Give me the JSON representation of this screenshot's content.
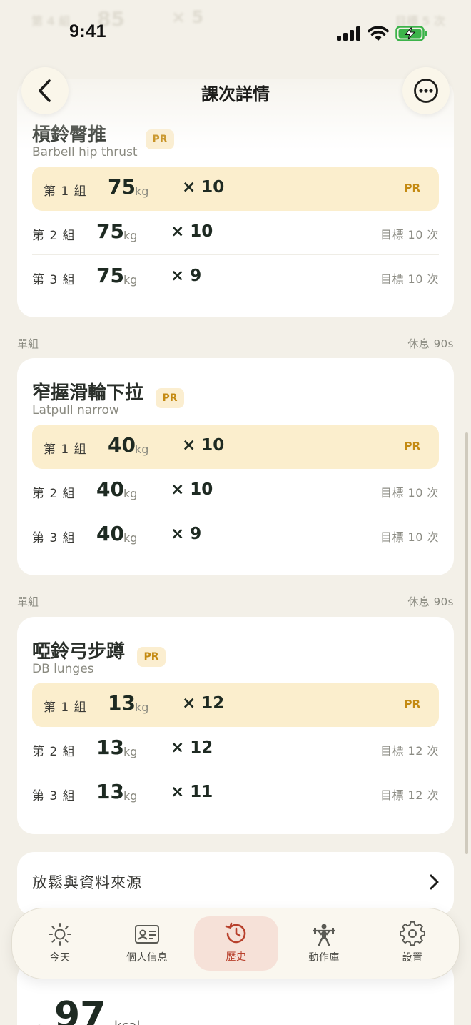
{
  "status_bar": {
    "time": "9:41"
  },
  "ghost_row": {
    "label": "第 4 組",
    "weight": "85",
    "reps": "× 5",
    "target": "目標 5 次"
  },
  "header": {
    "title": "課次詳情"
  },
  "exercises": [
    {
      "name": "槓鈴臀推",
      "subtitle": "Barbell hip thrust",
      "badge": "PR",
      "sets": [
        {
          "label": "第 1 組",
          "weight": "75",
          "unit": "kg",
          "reps": "× 10",
          "right": "PR"
        },
        {
          "label": "第 2 組",
          "weight": "75",
          "unit": "kg",
          "reps": "× 10",
          "right": "目標 10 次"
        },
        {
          "label": "第 3 組",
          "weight": "75",
          "unit": "kg",
          "reps": "× 9",
          "right": "目標 10 次"
        }
      ]
    },
    {
      "group_type": "單組",
      "rest": "休息 90s",
      "name": "窄握滑輪下拉",
      "subtitle": "Latpull narrow",
      "badge": "PR",
      "sets": [
        {
          "label": "第 1 組",
          "weight": "40",
          "unit": "kg",
          "reps": "× 10",
          "right": "PR"
        },
        {
          "label": "第 2 組",
          "weight": "40",
          "unit": "kg",
          "reps": "× 10",
          "right": "目標 10 次"
        },
        {
          "label": "第 3 組",
          "weight": "40",
          "unit": "kg",
          "reps": "× 9",
          "right": "目標 10 次"
        }
      ]
    },
    {
      "group_type": "單組",
      "rest": "休息 90s",
      "name": "啞鈴弓步蹲",
      "subtitle": "DB lunges",
      "badge": "PR",
      "sets": [
        {
          "label": "第 1 組",
          "weight": "13",
          "unit": "kg",
          "reps": "× 12",
          "right": "PR"
        },
        {
          "label": "第 2 組",
          "weight": "13",
          "unit": "kg",
          "reps": "× 12",
          "right": "目標 12 次"
        },
        {
          "label": "第 3 組",
          "weight": "13",
          "unit": "kg",
          "reps": "× 11",
          "right": "目標 12 次"
        }
      ]
    }
  ],
  "link_card": {
    "label": "放鬆與資料來源"
  },
  "bottom_card": {
    "value": "97",
    "unit": "kcal"
  },
  "tabs": [
    {
      "label": "今天",
      "icon": "sun-icon"
    },
    {
      "label": "個人信息",
      "icon": "id-card-icon"
    },
    {
      "label": "歷史",
      "icon": "history-icon",
      "active": true
    },
    {
      "label": "動作庫",
      "icon": "weightlifter-icon"
    },
    {
      "label": "設置",
      "icon": "gear-icon"
    }
  ],
  "colors": {
    "background": "#f3f0e8",
    "pr_highlight": "#fbeecd",
    "pr_text": "#c48a12",
    "active_tab": "#f6e1d8",
    "active_tab_text": "#b8402c"
  }
}
